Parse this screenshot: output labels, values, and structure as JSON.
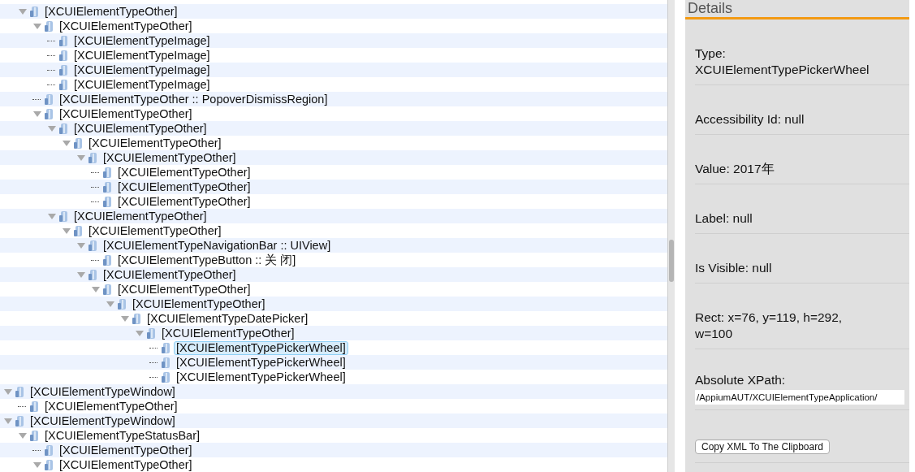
{
  "tree": {
    "items": [
      {
        "kind": "hidden_parent",
        "children": [
          {
            "kind": "group",
            "label": "[XCUIElementTypeOther]",
            "expanded": true,
            "selected": false,
            "children": [
              {
                "kind": "group",
                "label": "[XCUIElementTypeOther]",
                "expanded": true,
                "selected": false,
                "children": [
                  {
                    "kind": "leaf",
                    "label": "[XCUIElementTypeImage]",
                    "selected": false
                  },
                  {
                    "kind": "leaf",
                    "label": "[XCUIElementTypeImage]",
                    "selected": false
                  },
                  {
                    "kind": "leaf",
                    "label": "[XCUIElementTypeImage]",
                    "selected": false
                  },
                  {
                    "kind": "leaf",
                    "label": "[XCUIElementTypeImage]",
                    "selected": false
                  }
                ]
              },
              {
                "kind": "leaf",
                "label": "[XCUIElementTypeOther :: PopoverDismissRegion]",
                "selected": false
              },
              {
                "kind": "group",
                "label": "[XCUIElementTypeOther]",
                "expanded": true,
                "selected": false,
                "children": [
                  {
                    "kind": "group",
                    "label": "[XCUIElementTypeOther]",
                    "expanded": true,
                    "selected": false,
                    "children": [
                      {
                        "kind": "group",
                        "label": "[XCUIElementTypeOther]",
                        "expanded": true,
                        "selected": false,
                        "children": [
                          {
                            "kind": "group",
                            "label": "[XCUIElementTypeOther]",
                            "expanded": true,
                            "selected": false,
                            "children": [
                              {
                                "kind": "leaf",
                                "label": "[XCUIElementTypeOther]",
                                "selected": false
                              },
                              {
                                "kind": "leaf",
                                "label": "[XCUIElementTypeOther]",
                                "selected": false
                              },
                              {
                                "kind": "leaf",
                                "label": "[XCUIElementTypeOther]",
                                "selected": false
                              }
                            ]
                          }
                        ]
                      }
                    ]
                  },
                  {
                    "kind": "group",
                    "label": "[XCUIElementTypeOther]",
                    "expanded": true,
                    "selected": false,
                    "children": [
                      {
                        "kind": "group",
                        "label": "[XCUIElementTypeOther]",
                        "expanded": true,
                        "selected": false,
                        "children": [
                          {
                            "kind": "group",
                            "label": "[XCUIElementTypeNavigationBar :: UIView]",
                            "expanded": true,
                            "selected": false,
                            "children": [
                              {
                                "kind": "leaf",
                                "label": "[XCUIElementTypeButton :: 关 闭]",
                                "selected": false
                              }
                            ]
                          },
                          {
                            "kind": "group",
                            "label": "[XCUIElementTypeOther]",
                            "expanded": true,
                            "selected": false,
                            "children": [
                              {
                                "kind": "group",
                                "label": "[XCUIElementTypeOther]",
                                "expanded": true,
                                "selected": false,
                                "children": [
                                  {
                                    "kind": "group",
                                    "label": "[XCUIElementTypeOther]",
                                    "expanded": true,
                                    "selected": false,
                                    "children": [
                                      {
                                        "kind": "group",
                                        "label": "[XCUIElementTypeDatePicker]",
                                        "expanded": true,
                                        "selected": false,
                                        "children": [
                                          {
                                            "kind": "group",
                                            "label": "[XCUIElementTypeOther]",
                                            "expanded": true,
                                            "selected": false,
                                            "children": [
                                              {
                                                "kind": "leaf",
                                                "label": "[XCUIElementTypePickerWheel]",
                                                "selected": true
                                              },
                                              {
                                                "kind": "leaf",
                                                "label": "[XCUIElementTypePickerWheel]",
                                                "selected": false
                                              },
                                              {
                                                "kind": "leaf",
                                                "label": "[XCUIElementTypePickerWheel]",
                                                "selected": false
                                              }
                                            ]
                                          }
                                        ]
                                      }
                                    ]
                                  }
                                ]
                              }
                            ]
                          }
                        ]
                      }
                    ]
                  }
                ]
              }
            ]
          }
        ]
      },
      {
        "kind": "group",
        "label": "[XCUIElementTypeWindow]",
        "expanded": true,
        "selected": false,
        "children": [
          {
            "kind": "leaf",
            "label": "[XCUIElementTypeOther]",
            "selected": false
          }
        ]
      },
      {
        "kind": "group",
        "label": "[XCUIElementTypeWindow]",
        "expanded": true,
        "selected": false,
        "children": [
          {
            "kind": "group",
            "label": "[XCUIElementTypeStatusBar]",
            "expanded": true,
            "selected": false,
            "children": [
              {
                "kind": "leaf",
                "label": "[XCUIElementTypeOther]",
                "selected": false
              },
              {
                "kind": "group",
                "label": "[XCUIElementTypeOther]",
                "expanded": true,
                "selected": false
              }
            ]
          }
        ]
      }
    ]
  },
  "details": {
    "title": "Details",
    "rows": [
      {
        "kind": "text",
        "text": "Type: XCUIElementTypePickerWheel"
      },
      {
        "kind": "text",
        "text": "Accessibility Id: null"
      },
      {
        "kind": "text",
        "text": "Value: 2017年"
      },
      {
        "kind": "text",
        "text": "Label: null"
      },
      {
        "kind": "text",
        "text": "Is Visible: null"
      },
      {
        "kind": "text",
        "text": "Rect: x=76, y=119, h=292, w=100"
      },
      {
        "kind": "xpath",
        "label": "Absolute XPath:",
        "value": "/AppiumAUT/XCUIElementTypeApplication/"
      },
      {
        "kind": "button",
        "label": "Copy XML To The Clipboard"
      }
    ]
  }
}
